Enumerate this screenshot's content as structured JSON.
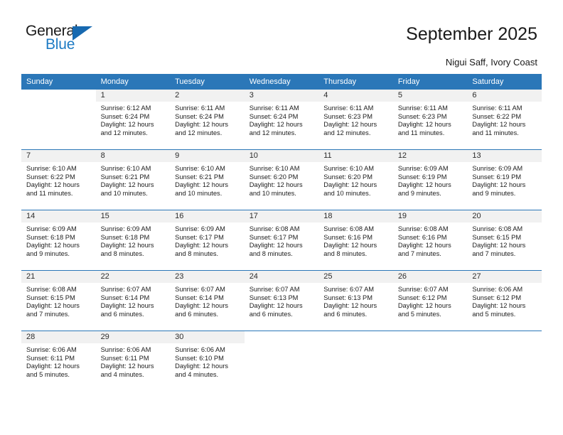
{
  "brand": {
    "name_top": "General",
    "name_bottom": "Blue",
    "accent_color": "#1769b0"
  },
  "header": {
    "title": "September 2025",
    "subtitle": "Nigui Saff, Ivory Coast",
    "header_bg": "#2b75b8"
  },
  "calendar": {
    "weekdays": [
      "Sunday",
      "Monday",
      "Tuesday",
      "Wednesday",
      "Thursday",
      "Friday",
      "Saturday"
    ],
    "weeks": [
      [
        {
          "day": "",
          "sunrise": "",
          "sunset": "",
          "daylight1": "",
          "daylight2": ""
        },
        {
          "day": "1",
          "sunrise": "Sunrise: 6:12 AM",
          "sunset": "Sunset: 6:24 PM",
          "daylight1": "Daylight: 12 hours",
          "daylight2": "and 12 minutes."
        },
        {
          "day": "2",
          "sunrise": "Sunrise: 6:11 AM",
          "sunset": "Sunset: 6:24 PM",
          "daylight1": "Daylight: 12 hours",
          "daylight2": "and 12 minutes."
        },
        {
          "day": "3",
          "sunrise": "Sunrise: 6:11 AM",
          "sunset": "Sunset: 6:24 PM",
          "daylight1": "Daylight: 12 hours",
          "daylight2": "and 12 minutes."
        },
        {
          "day": "4",
          "sunrise": "Sunrise: 6:11 AM",
          "sunset": "Sunset: 6:23 PM",
          "daylight1": "Daylight: 12 hours",
          "daylight2": "and 12 minutes."
        },
        {
          "day": "5",
          "sunrise": "Sunrise: 6:11 AM",
          "sunset": "Sunset: 6:23 PM",
          "daylight1": "Daylight: 12 hours",
          "daylight2": "and 11 minutes."
        },
        {
          "day": "6",
          "sunrise": "Sunrise: 6:11 AM",
          "sunset": "Sunset: 6:22 PM",
          "daylight1": "Daylight: 12 hours",
          "daylight2": "and 11 minutes."
        }
      ],
      [
        {
          "day": "7",
          "sunrise": "Sunrise: 6:10 AM",
          "sunset": "Sunset: 6:22 PM",
          "daylight1": "Daylight: 12 hours",
          "daylight2": "and 11 minutes."
        },
        {
          "day": "8",
          "sunrise": "Sunrise: 6:10 AM",
          "sunset": "Sunset: 6:21 PM",
          "daylight1": "Daylight: 12 hours",
          "daylight2": "and 10 minutes."
        },
        {
          "day": "9",
          "sunrise": "Sunrise: 6:10 AM",
          "sunset": "Sunset: 6:21 PM",
          "daylight1": "Daylight: 12 hours",
          "daylight2": "and 10 minutes."
        },
        {
          "day": "10",
          "sunrise": "Sunrise: 6:10 AM",
          "sunset": "Sunset: 6:20 PM",
          "daylight1": "Daylight: 12 hours",
          "daylight2": "and 10 minutes."
        },
        {
          "day": "11",
          "sunrise": "Sunrise: 6:10 AM",
          "sunset": "Sunset: 6:20 PM",
          "daylight1": "Daylight: 12 hours",
          "daylight2": "and 10 minutes."
        },
        {
          "day": "12",
          "sunrise": "Sunrise: 6:09 AM",
          "sunset": "Sunset: 6:19 PM",
          "daylight1": "Daylight: 12 hours",
          "daylight2": "and 9 minutes."
        },
        {
          "day": "13",
          "sunrise": "Sunrise: 6:09 AM",
          "sunset": "Sunset: 6:19 PM",
          "daylight1": "Daylight: 12 hours",
          "daylight2": "and 9 minutes."
        }
      ],
      [
        {
          "day": "14",
          "sunrise": "Sunrise: 6:09 AM",
          "sunset": "Sunset: 6:18 PM",
          "daylight1": "Daylight: 12 hours",
          "daylight2": "and 9 minutes."
        },
        {
          "day": "15",
          "sunrise": "Sunrise: 6:09 AM",
          "sunset": "Sunset: 6:18 PM",
          "daylight1": "Daylight: 12 hours",
          "daylight2": "and 8 minutes."
        },
        {
          "day": "16",
          "sunrise": "Sunrise: 6:09 AM",
          "sunset": "Sunset: 6:17 PM",
          "daylight1": "Daylight: 12 hours",
          "daylight2": "and 8 minutes."
        },
        {
          "day": "17",
          "sunrise": "Sunrise: 6:08 AM",
          "sunset": "Sunset: 6:17 PM",
          "daylight1": "Daylight: 12 hours",
          "daylight2": "and 8 minutes."
        },
        {
          "day": "18",
          "sunrise": "Sunrise: 6:08 AM",
          "sunset": "Sunset: 6:16 PM",
          "daylight1": "Daylight: 12 hours",
          "daylight2": "and 8 minutes."
        },
        {
          "day": "19",
          "sunrise": "Sunrise: 6:08 AM",
          "sunset": "Sunset: 6:16 PM",
          "daylight1": "Daylight: 12 hours",
          "daylight2": "and 7 minutes."
        },
        {
          "day": "20",
          "sunrise": "Sunrise: 6:08 AM",
          "sunset": "Sunset: 6:15 PM",
          "daylight1": "Daylight: 12 hours",
          "daylight2": "and 7 minutes."
        }
      ],
      [
        {
          "day": "21",
          "sunrise": "Sunrise: 6:08 AM",
          "sunset": "Sunset: 6:15 PM",
          "daylight1": "Daylight: 12 hours",
          "daylight2": "and 7 minutes."
        },
        {
          "day": "22",
          "sunrise": "Sunrise: 6:07 AM",
          "sunset": "Sunset: 6:14 PM",
          "daylight1": "Daylight: 12 hours",
          "daylight2": "and 6 minutes."
        },
        {
          "day": "23",
          "sunrise": "Sunrise: 6:07 AM",
          "sunset": "Sunset: 6:14 PM",
          "daylight1": "Daylight: 12 hours",
          "daylight2": "and 6 minutes."
        },
        {
          "day": "24",
          "sunrise": "Sunrise: 6:07 AM",
          "sunset": "Sunset: 6:13 PM",
          "daylight1": "Daylight: 12 hours",
          "daylight2": "and 6 minutes."
        },
        {
          "day": "25",
          "sunrise": "Sunrise: 6:07 AM",
          "sunset": "Sunset: 6:13 PM",
          "daylight1": "Daylight: 12 hours",
          "daylight2": "and 6 minutes."
        },
        {
          "day": "26",
          "sunrise": "Sunrise: 6:07 AM",
          "sunset": "Sunset: 6:12 PM",
          "daylight1": "Daylight: 12 hours",
          "daylight2": "and 5 minutes."
        },
        {
          "day": "27",
          "sunrise": "Sunrise: 6:06 AM",
          "sunset": "Sunset: 6:12 PM",
          "daylight1": "Daylight: 12 hours",
          "daylight2": "and 5 minutes."
        }
      ],
      [
        {
          "day": "28",
          "sunrise": "Sunrise: 6:06 AM",
          "sunset": "Sunset: 6:11 PM",
          "daylight1": "Daylight: 12 hours",
          "daylight2": "and 5 minutes."
        },
        {
          "day": "29",
          "sunrise": "Sunrise: 6:06 AM",
          "sunset": "Sunset: 6:11 PM",
          "daylight1": "Daylight: 12 hours",
          "daylight2": "and 4 minutes."
        },
        {
          "day": "30",
          "sunrise": "Sunrise: 6:06 AM",
          "sunset": "Sunset: 6:10 PM",
          "daylight1": "Daylight: 12 hours",
          "daylight2": "and 4 minutes."
        },
        {
          "day": "",
          "sunrise": "",
          "sunset": "",
          "daylight1": "",
          "daylight2": ""
        },
        {
          "day": "",
          "sunrise": "",
          "sunset": "",
          "daylight1": "",
          "daylight2": ""
        },
        {
          "day": "",
          "sunrise": "",
          "sunset": "",
          "daylight1": "",
          "daylight2": ""
        },
        {
          "day": "",
          "sunrise": "",
          "sunset": "",
          "daylight1": "",
          "daylight2": ""
        }
      ]
    ]
  }
}
